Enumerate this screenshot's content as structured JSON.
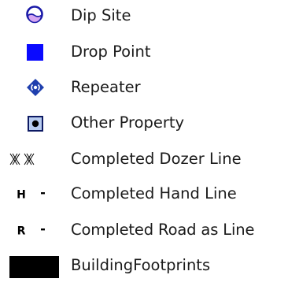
{
  "legend": {
    "items": [
      {
        "icon": "dip-site-icon",
        "label": "Dip Site"
      },
      {
        "icon": "drop-point-icon",
        "label": "Drop Point"
      },
      {
        "icon": "repeater-icon",
        "label": "Repeater"
      },
      {
        "icon": "other-property-icon",
        "label": "Other Property"
      },
      {
        "icon": "completed-dozer-line-icon",
        "label": "Completed Dozer Line"
      },
      {
        "icon": "completed-hand-line-icon",
        "label": "Completed Hand Line",
        "symbol_text": "H"
      },
      {
        "icon": "completed-road-as-line-icon",
        "label": "Completed Road as Line",
        "symbol_text": "R"
      },
      {
        "icon": "building-footprints-icon",
        "label": "BuildingFootprints"
      }
    ]
  },
  "colors": {
    "dip_site": "#1a1aa8",
    "dip_site_fill": "#d6a6f2",
    "drop_point": "#0a0aff",
    "repeater": "#1f3fae",
    "other_property": "#0d1a63",
    "other_property_fill": "#b8ccf0",
    "line_symbol": "#000000",
    "building_footprints": "#000000"
  }
}
